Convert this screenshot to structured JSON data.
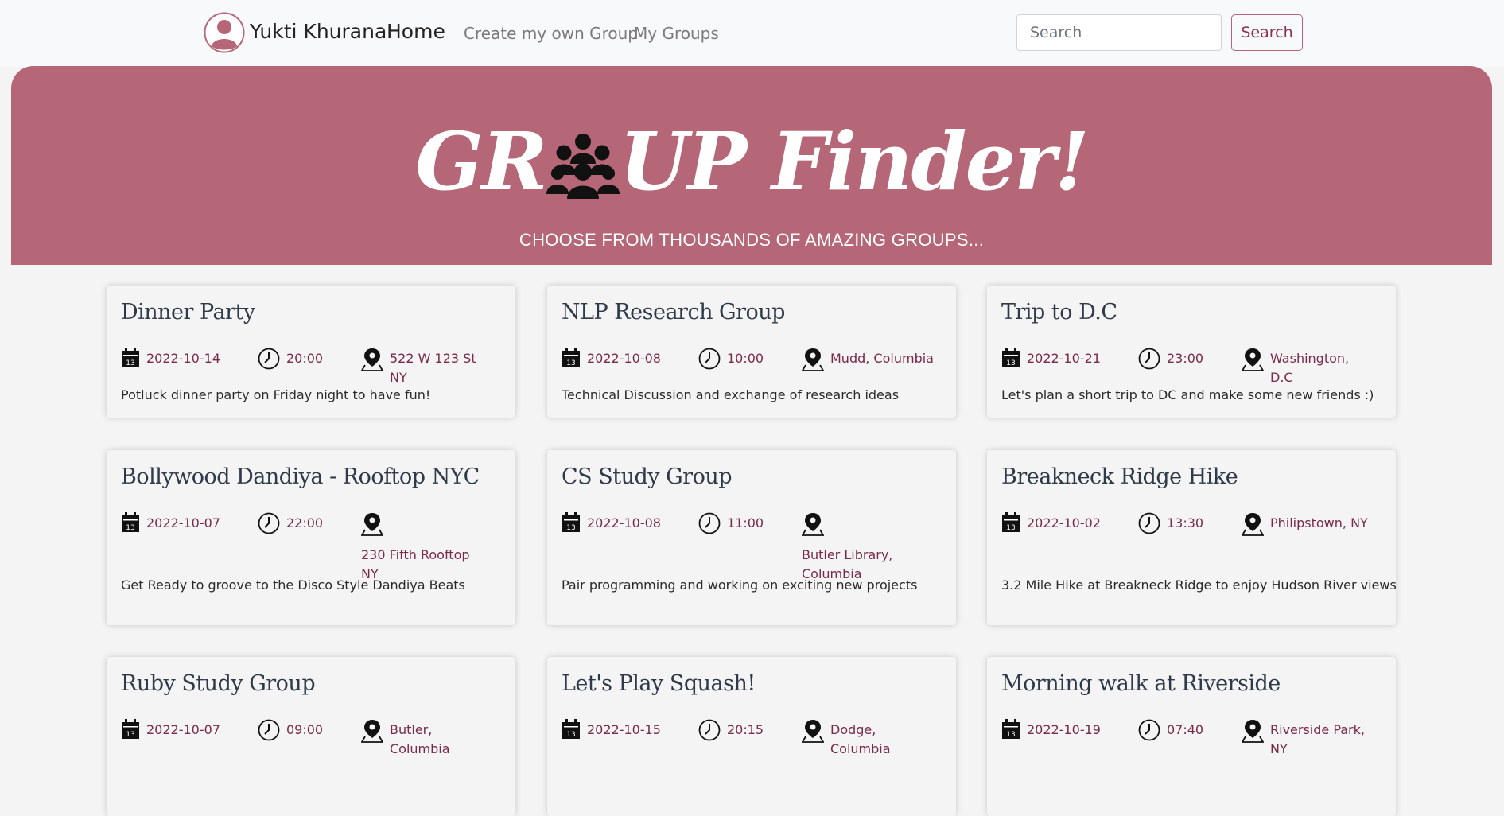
{
  "navbar": {
    "user_name": "Yukti Khurana",
    "home_label": "Home",
    "create_label": "Create my own Group",
    "mygroups_label": "My Groups",
    "search_placeholder": "Search",
    "search_button_label": "Search"
  },
  "hero": {
    "title_left": "GR",
    "title_right": "UP Finder!",
    "subtitle": "CHOOSE FROM THOUSANDS OF AMAZING GROUPS..."
  },
  "colors": {
    "hero_bg": "#b56677",
    "accent_text": "#7a2a48",
    "card_title": "#2e3a4a"
  },
  "calendar_icon_day": "13",
  "groups": [
    {
      "title": "Dinner Party",
      "date": "2022-10-14",
      "time": "20:00",
      "location": "522 W 123 St NY",
      "description": "Potluck dinner party on Friday night to have fun!"
    },
    {
      "title": "NLP Research Group",
      "date": "2022-10-08",
      "time": "10:00",
      "location": "Mudd, Columbia",
      "description": "Technical Discussion and exchange of research ideas"
    },
    {
      "title": "Trip to D.C",
      "date": "2022-10-21",
      "time": "23:00",
      "location": "Washington, D.C",
      "description": "Let's plan a short trip to DC and make some new friends :)"
    },
    {
      "title": "Bollywood Dandiya - Rooftop NYC",
      "date": "2022-10-07",
      "time": "22:00",
      "location": "230 Fifth Rooftop NY",
      "description": "Get Ready to groove to the Disco Style Dandiya Beats"
    },
    {
      "title": "CS Study Group",
      "date": "2022-10-08",
      "time": "11:00",
      "location": "Butler Library, Columbia",
      "description": "Pair programming and working on exciting new projects"
    },
    {
      "title": "Breakneck Ridge Hike",
      "date": "2022-10-02",
      "time": "13:30",
      "location": "Philipstown, NY",
      "description": "3.2 Mile Hike at Breakneck Ridge to enjoy Hudson River views"
    },
    {
      "title": "Ruby Study Group",
      "date": "2022-10-07",
      "time": "09:00",
      "location": "Butler, Columbia",
      "description": ""
    },
    {
      "title": "Let's Play Squash!",
      "date": "2022-10-15",
      "time": "20:15",
      "location": "Dodge, Columbia",
      "description": ""
    },
    {
      "title": "Morning walk at Riverside",
      "date": "2022-10-19",
      "time": "07:40",
      "location": "Riverside Park, NY",
      "description": ""
    }
  ]
}
